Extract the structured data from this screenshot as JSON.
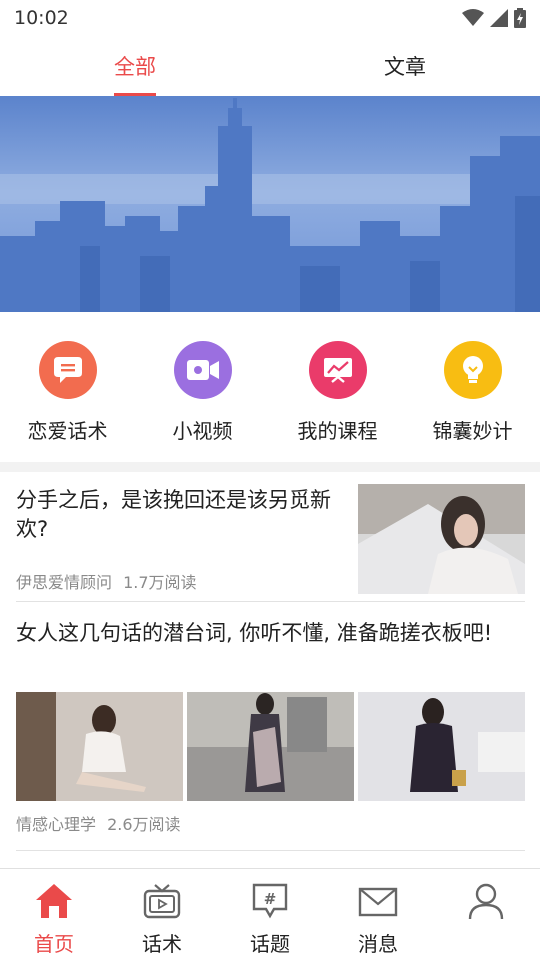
{
  "status_bar": {
    "time": "10:02"
  },
  "top_tabs": [
    {
      "label": "全部",
      "active": true
    },
    {
      "label": "文章",
      "active": false
    }
  ],
  "categories": [
    {
      "label": "恋爱话术",
      "icon": "chat-bubble-icon",
      "color": "#f26c4f"
    },
    {
      "label": "小视频",
      "icon": "video-camera-icon",
      "color": "#9b6fe0"
    },
    {
      "label": "我的课程",
      "icon": "chart-board-icon",
      "color": "#ea3b6a"
    },
    {
      "label": "锦囊妙计",
      "icon": "lightbulb-icon",
      "color": "#f8bd12"
    }
  ],
  "articles": [
    {
      "title": "分手之后，是该挽回还是该另觅新欢?",
      "author": "伊思爱情顾问",
      "reads": "1.7万阅读"
    },
    {
      "title": "女人这几句话的潜台词, 你听不懂, 准备跪搓衣板吧!",
      "author": "情感心理学",
      "reads": "2.6万阅读"
    }
  ],
  "bottom_nav": [
    {
      "label": "首页",
      "icon": "home-icon",
      "active": true
    },
    {
      "label": "话术",
      "icon": "tv-icon",
      "active": false
    },
    {
      "label": "话题",
      "icon": "topic-hash-icon",
      "active": false
    },
    {
      "label": "消息",
      "icon": "mail-icon",
      "active": false
    },
    {
      "label": "",
      "icon": "user-icon",
      "active": false
    }
  ],
  "colors": {
    "accent": "#ea4a4a",
    "banner_blue": "#5f86cc"
  }
}
